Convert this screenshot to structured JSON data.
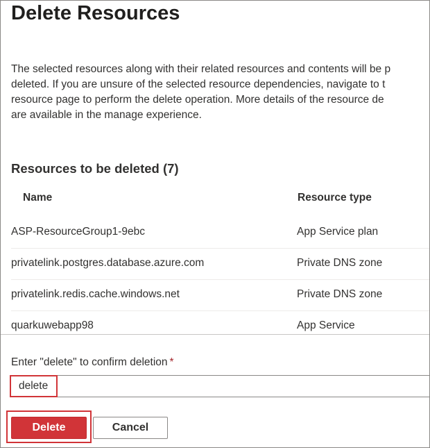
{
  "dialog": {
    "title": "Delete Resources",
    "description_lines": [
      "The selected resources along with their related resources and contents will be p",
      "deleted. If you are unsure of the selected resource dependencies, navigate to t",
      "resource page to perform the delete operation. More details of the resource de",
      "are available in the manage experience."
    ]
  },
  "resources": {
    "section_title": "Resources to be deleted (7)",
    "columns": {
      "name": "Name",
      "type": "Resource type"
    },
    "rows": [
      {
        "name": "ASP-ResourceGroup1-9ebc",
        "type": "App Service plan"
      },
      {
        "name": "privatelink.postgres.database.azure.com",
        "type": "Private DNS zone"
      },
      {
        "name": "privatelink.redis.cache.windows.net",
        "type": "Private DNS zone"
      },
      {
        "name": "quarkuwebapp98",
        "type": "App Service"
      }
    ]
  },
  "confirm": {
    "label": "Enter \"delete\" to confirm deletion",
    "required_mark": "*",
    "value": "delete"
  },
  "buttons": {
    "delete": "Delete",
    "cancel": "Cancel"
  },
  "colors": {
    "danger": "#d13438",
    "text": "#323130"
  }
}
